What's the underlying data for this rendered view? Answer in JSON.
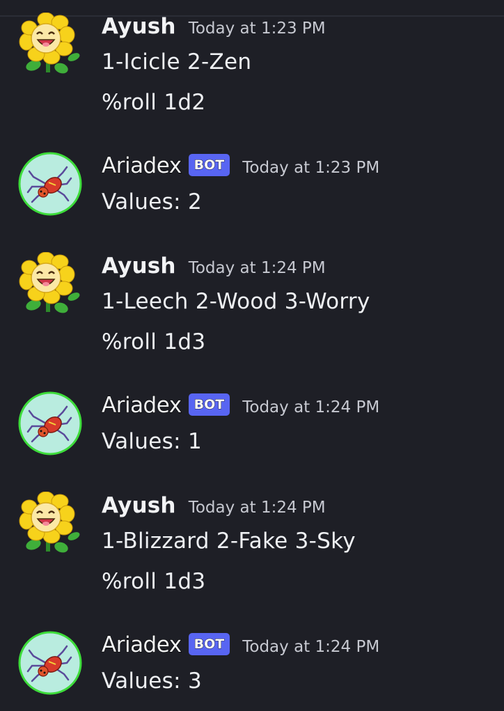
{
  "colors": {
    "background": "#1e1f26",
    "bot_badge": "#5865f2",
    "bot_avatar_bg": "#b9ecdf",
    "bot_avatar_ring": "#3ddc3a",
    "timestamp": "#c7c9d1"
  },
  "messages": [
    {
      "author": "Ayush",
      "avatar_icon": "sunflower-avatar",
      "is_bot": false,
      "timestamp": "Today at 1:23 PM",
      "lines": [
        "1-Icicle 2-Zen",
        "%roll 1d2"
      ]
    },
    {
      "author": "Ariadex",
      "avatar_icon": "spider-avatar",
      "is_bot": true,
      "badge": "BOT",
      "timestamp": "Today at 1:23 PM",
      "lines": [
        "Values: 2"
      ]
    },
    {
      "author": "Ayush",
      "avatar_icon": "sunflower-avatar",
      "is_bot": false,
      "timestamp": "Today at 1:24 PM",
      "lines": [
        "1-Leech 2-Wood 3-Worry",
        "%roll 1d3"
      ]
    },
    {
      "author": "Ariadex",
      "avatar_icon": "spider-avatar",
      "is_bot": true,
      "badge": "BOT",
      "timestamp": "Today at 1:24 PM",
      "lines": [
        "Values: 1"
      ]
    },
    {
      "author": "Ayush",
      "avatar_icon": "sunflower-avatar",
      "is_bot": false,
      "timestamp": "Today at 1:24 PM",
      "lines": [
        "1-Blizzard 2-Fake 3-Sky",
        "%roll 1d3"
      ]
    },
    {
      "author": "Ariadex",
      "avatar_icon": "spider-avatar",
      "is_bot": true,
      "badge": "BOT",
      "timestamp": "Today at 1:24 PM",
      "lines": [
        "Values: 3"
      ]
    }
  ]
}
